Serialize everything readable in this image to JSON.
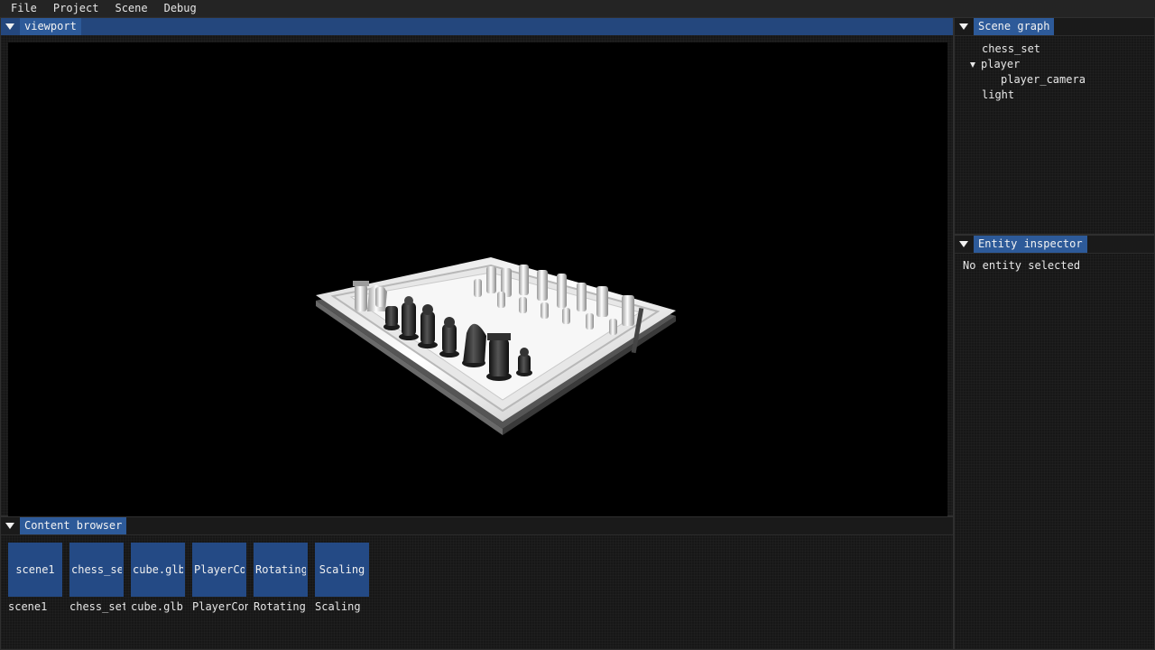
{
  "menu": {
    "file": "File",
    "project": "Project",
    "scene": "Scene",
    "debug": "Debug"
  },
  "viewport": {
    "title": "viewport"
  },
  "content_browser": {
    "title": "Content browser",
    "items": [
      {
        "thumb": "scene1",
        "label": "scene1"
      },
      {
        "thumb": "chess_set",
        "label": "chess_set"
      },
      {
        "thumb": "cube.glb",
        "label": "cube.glb"
      },
      {
        "thumb": "PlayerController",
        "label": "PlayerController"
      },
      {
        "thumb": "Rotating",
        "label": "Rotating"
      },
      {
        "thumb": "Scaling",
        "label": "Scaling"
      }
    ]
  },
  "scene_graph": {
    "title": "Scene graph",
    "nodes": [
      {
        "label": "chess_set"
      },
      {
        "label": "player"
      },
      {
        "label": "player_camera"
      },
      {
        "label": "light"
      }
    ]
  },
  "entity_inspector": {
    "title": "Entity inspector",
    "empty_text": "No entity selected"
  },
  "colors": {
    "accent_tab": "#2d5a99",
    "active_bar": "#24477d",
    "content_tile": "#244a85",
    "panel_bg": "#171717",
    "viewport_bg": "#000000"
  }
}
